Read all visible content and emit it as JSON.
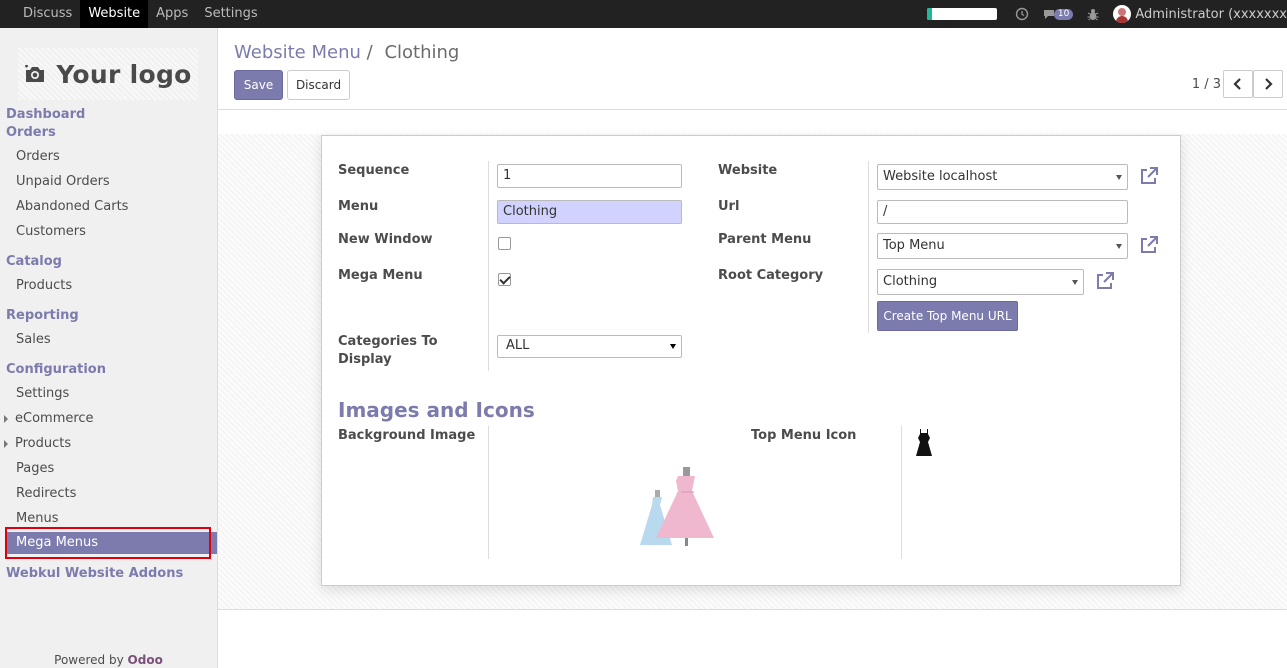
{
  "topbar": {
    "nav": [
      "Discuss",
      "Website",
      "Apps",
      "Settings"
    ],
    "active_nav": "Website",
    "progress": 0.08,
    "chat_count": "10",
    "user": "Administrator (xxxxxxx"
  },
  "sidebar": {
    "logo_text": "Your logo",
    "heading_dashboard": "Dashboard",
    "heading_orders": "Orders",
    "orders_items": [
      "Orders",
      "Unpaid Orders",
      "Abandoned Carts",
      "Customers"
    ],
    "heading_catalog": "Catalog",
    "catalog_items": [
      "Products"
    ],
    "heading_reporting": "Reporting",
    "reporting_items": [
      "Sales"
    ],
    "heading_configuration": "Configuration",
    "config_items": [
      "Settings",
      "eCommerce",
      "Products",
      "Pages",
      "Redirects",
      "Menus",
      "Mega Menus"
    ],
    "heading_webkul": "Webkul Website Addons",
    "powered_prefix": "Powered by",
    "powered_brand": "Odoo"
  },
  "control": {
    "breadcrumb_parent": "Website Menu",
    "breadcrumb_sep": "/",
    "breadcrumb_current": "Clothing",
    "save_label": "Save",
    "discard_label": "Discard",
    "pager": "1 / 3"
  },
  "form": {
    "sequence_label": "Sequence",
    "sequence_value": "1",
    "menu_label": "Menu",
    "menu_value": "Clothing",
    "new_window_label": "New Window",
    "new_window_checked": false,
    "mega_menu_label": "Mega Menu",
    "mega_menu_checked": true,
    "categories_label_1": "Categories To",
    "categories_label_2": "Display",
    "categories_value": "ALL",
    "website_label": "Website",
    "website_value": "Website localhost",
    "url_label": "Url",
    "url_value": "/",
    "parent_menu_label": "Parent Menu",
    "parent_menu_value": "Top Menu",
    "root_category_label": "Root Category",
    "root_category_value": "Clothing",
    "create_button": "Create Top Menu URL",
    "section_title": "Images and Icons",
    "background_image_label": "Background Image",
    "top_menu_icon_label": "Top Menu Icon"
  },
  "colors": {
    "accent": "#7c7bad",
    "topbar": "#222222",
    "highlight_input": "#d2d2ff",
    "annotation_box": "#e0000d"
  }
}
